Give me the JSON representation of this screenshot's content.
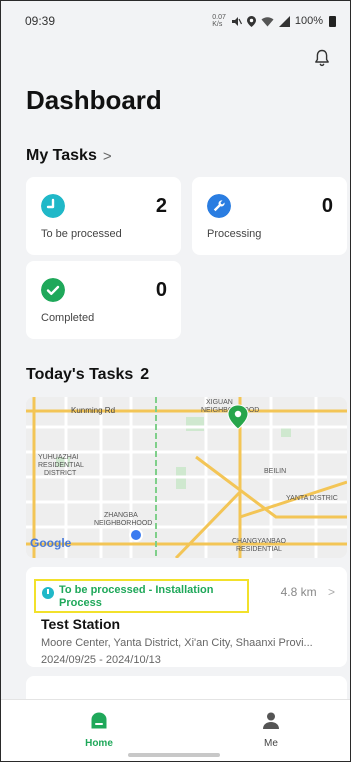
{
  "status_bar": {
    "time": "09:39",
    "net_top": "0.07",
    "net_bottom": "K/s",
    "battery": "100%"
  },
  "header": {
    "title": "Dashboard",
    "bell_icon": "bell-icon"
  },
  "my_tasks": {
    "label": "My Tasks",
    "chevron": ">",
    "cards": [
      {
        "label": "To be processed",
        "count": "2",
        "icon": "clock-icon",
        "color": "#20b8c8"
      },
      {
        "label": "Processing",
        "count": "0",
        "icon": "wrench-icon",
        "color": "#2a7de1"
      },
      {
        "label": "Completed",
        "count": "0",
        "icon": "check-icon",
        "color": "#1fa85a"
      }
    ]
  },
  "today_tasks": {
    "label": "Today's Tasks",
    "count": "2"
  },
  "map": {
    "labels": {
      "kunming_rd": "Kunming Rd",
      "xiguan_1": "XIGUAN",
      "xiguan_2": "NEIGHBORHOOD",
      "yuhuazhai_1": "YUHUAZHAI",
      "yuhuazhai_2": "RESIDENTIAL",
      "yuhuazhai_3": "DISTRICT",
      "beilin": "BEILIN",
      "yanta": "YANTA DISTRIC",
      "zhangba_1": "ZHANGBA",
      "zhangba_2": "NEIGHBORHOOD",
      "changyanbao_1": "CHANGYANBAO",
      "changyanbao_2": "RESIDENTIAL",
      "google": "Google"
    },
    "pin_color": "#27a54b",
    "location_color": "#3a7bf0"
  },
  "task": {
    "status": "To be processed - Installation Process",
    "distance": "4.8 km",
    "chevron": ">",
    "station": "Test Station",
    "address": "Moore Center, Yanta District, Xi'an City, Shaanxi Provi...",
    "dates": "2024/09/25 - 2024/10/13"
  },
  "bottom_nav": {
    "home": "Home",
    "me": "Me",
    "accent": "#1fa85a"
  }
}
